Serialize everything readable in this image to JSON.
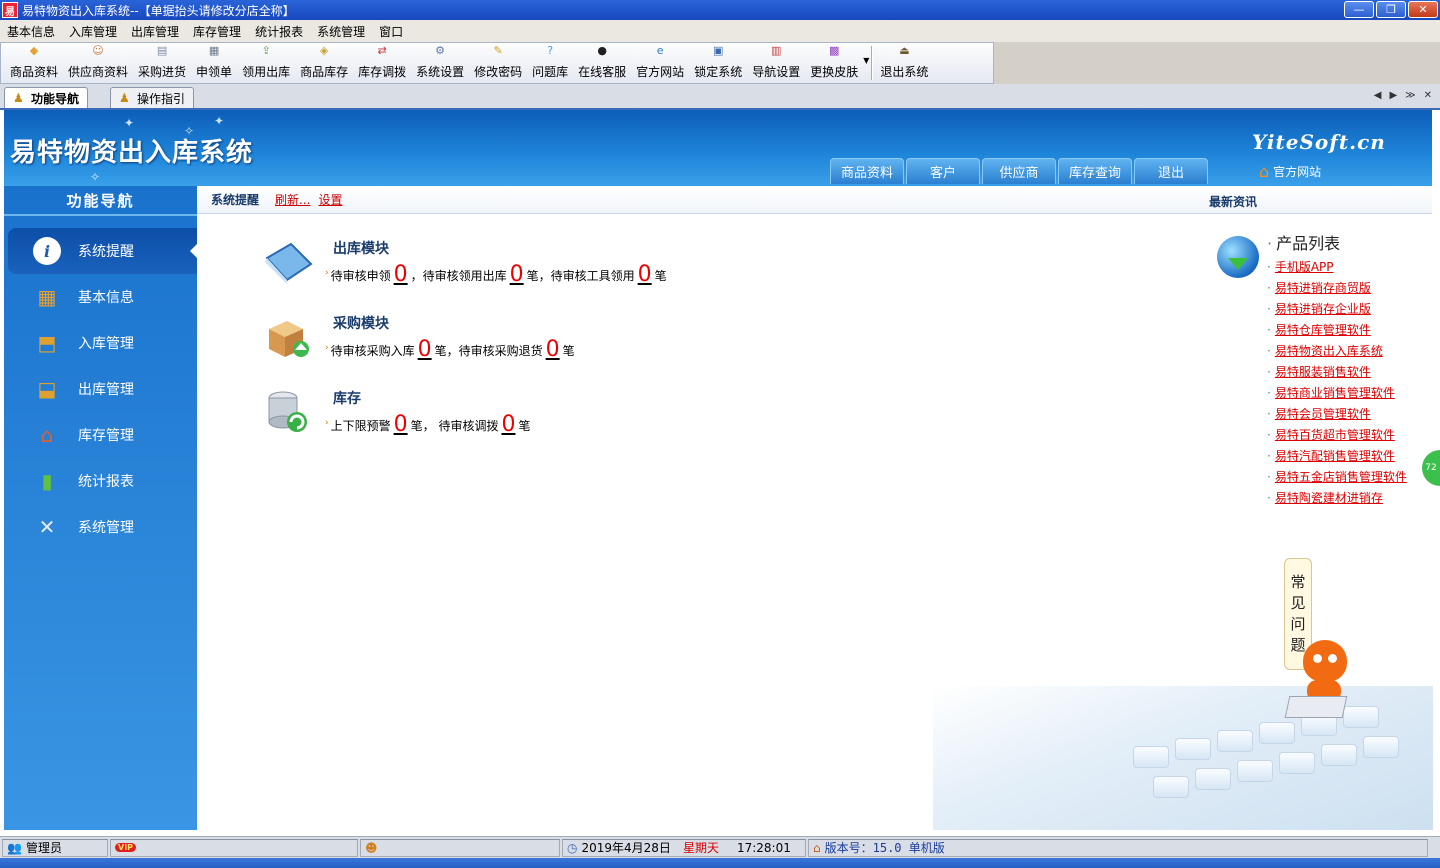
{
  "window": {
    "title": "易特物资出入库系统--【单据抬头请修改分店全称】",
    "app_icon": "易",
    "minimize": "—",
    "maximize": "❐",
    "close": "✕"
  },
  "menu": [
    "基本信息",
    "入库管理",
    "出库管理",
    "库存管理",
    "统计报表",
    "系统管理",
    "窗口"
  ],
  "toolbar": [
    {
      "label": "商品资料",
      "icon": "goods-icon",
      "color": "#e8a030"
    },
    {
      "label": "供应商资料",
      "icon": "supplier-icon",
      "color": "#d07840"
    },
    {
      "label": "采购进货",
      "icon": "purchase-icon",
      "color": "#7a8aa0"
    },
    {
      "label": "申领单",
      "icon": "requisition-icon",
      "color": "#6a7a8a"
    },
    {
      "label": "领用出库",
      "icon": "outbound-icon",
      "color": "#5aa040"
    },
    {
      "label": "商品库存",
      "icon": "stock-icon",
      "color": "#c8a030"
    },
    {
      "label": "库存调拨",
      "icon": "transfer-icon",
      "color": "#d03030"
    },
    {
      "label": "系统设置",
      "icon": "settings-icon",
      "color": "#5a7ab0"
    },
    {
      "label": "修改密码",
      "icon": "password-icon",
      "color": "#d0a020"
    },
    {
      "label": "问题库",
      "icon": "question-icon",
      "color": "#40a0e0"
    },
    {
      "label": "在线客服",
      "icon": "qq-icon",
      "color": "#202020"
    },
    {
      "label": "官方网站",
      "icon": "ie-icon",
      "color": "#2a7ad0"
    },
    {
      "label": "锁定系统",
      "icon": "lock-icon",
      "color": "#3a6ab0"
    },
    {
      "label": "导航设置",
      "icon": "nav-settings-icon",
      "color": "#c04040"
    },
    {
      "label": "更换皮肤",
      "icon": "skin-icon",
      "color": "#9040c0"
    },
    {
      "label": "退出系统",
      "icon": "exit-icon",
      "color": "#6a5a30"
    }
  ],
  "tabs": [
    {
      "label": "功能导航",
      "active": true
    },
    {
      "label": "操作指引",
      "active": false
    }
  ],
  "header": {
    "title": "易特物资出入库系统",
    "logo": "YiteSoft.cn",
    "nav": [
      "商品资料",
      "客户",
      "供应商",
      "库存查询",
      "退出"
    ],
    "site_link": "官方网站"
  },
  "sidebar": {
    "title": "功能导航",
    "items": [
      {
        "label": "系统提醒",
        "icon": "info-icon",
        "active": true
      },
      {
        "label": "基本信息",
        "icon": "cubes-icon",
        "active": false
      },
      {
        "label": "入库管理",
        "icon": "inbound-box-icon",
        "active": false
      },
      {
        "label": "出库管理",
        "icon": "outbound-box-icon",
        "active": false
      },
      {
        "label": "库存管理",
        "icon": "warehouse-icon",
        "active": false
      },
      {
        "label": "统计报表",
        "icon": "bar-chart-icon",
        "active": false
      },
      {
        "label": "系统管理",
        "icon": "tools-icon",
        "active": false
      }
    ]
  },
  "content": {
    "bar_title": "系统提醒",
    "refresh": "刷新...",
    "settings": "设置",
    "news_title": "最新资讯",
    "modules": [
      {
        "title": "出库模块",
        "icon": "book-icon",
        "parts": [
          {
            "text": "待审核申领",
            "num": "0"
          },
          {
            "text": "，待审核领用出库",
            "num": "0"
          },
          {
            "text": "笔，待审核工具领用",
            "num": "0"
          },
          {
            "text": "笔",
            "num": null
          }
        ]
      },
      {
        "title": "采购模块",
        "icon": "package-icon",
        "parts": [
          {
            "text": "待审核采购入库",
            "num": "0"
          },
          {
            "text": "笔，待审核采购退货",
            "num": "0"
          },
          {
            "text": "笔",
            "num": null
          }
        ]
      },
      {
        "title": "库存",
        "icon": "database-icon",
        "parts": [
          {
            "text": "上下限预警",
            "num": "0"
          },
          {
            "text": "笔， 待审核调拨",
            "num": "0"
          },
          {
            "text": "笔",
            "num": null
          }
        ]
      }
    ],
    "products": {
      "title": "产品列表",
      "items": [
        "手机版APP",
        "易特进销存商贸版",
        "易特进销存企业版",
        "易特仓库管理软件",
        "易特物资出入库系统",
        "易特服装销售软件",
        "易特商业销售管理软件",
        "易特会员管理软件",
        "易特百货超市管理软件",
        "易特汽配销售管理软件",
        "易特五金店销售管理软件",
        "易特陶瓷建材进销存"
      ]
    },
    "faq": [
      "常",
      "见",
      "问",
      "题"
    ],
    "side_badge": "72"
  },
  "status": {
    "user": "管理员",
    "vip": "VIP",
    "date": "2019年4月28日",
    "weekday": "星期天",
    "time": "17:28:01",
    "version": "版本号：15.0 单机版"
  },
  "colors": {
    "header_blue": "#1f86da",
    "number_red": "#e00000",
    "link_red": "#d00000",
    "weekday_red": "#e00000"
  }
}
